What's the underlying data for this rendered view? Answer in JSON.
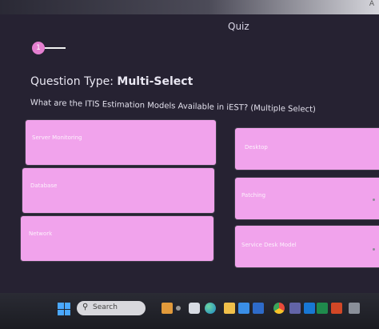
{
  "header": {
    "title": "Quiz",
    "corner_text": "A"
  },
  "progress": {
    "current_step": "1"
  },
  "question": {
    "type_label": "Question Type:",
    "type_value": "Multi-Select",
    "text": "What are the ITIS Estimation Models Available in iEST? (Multiple Select)"
  },
  "options": [
    {
      "label": "Server Monitoring"
    },
    {
      "label": "Desktop"
    },
    {
      "label": "Database"
    },
    {
      "label": "Patching"
    },
    {
      "label": "Network"
    },
    {
      "label": "Service Desk Model"
    }
  ],
  "taskbar": {
    "search_placeholder": "Search",
    "icons": [
      "windows-start-icon",
      "search-icon",
      "briefcase-icon",
      "camera-icon",
      "edge-icon",
      "folder-icon",
      "store-icon",
      "word-icon",
      "chrome-icon",
      "teams-icon",
      "outlook-icon",
      "excel-icon",
      "powerpoint-icon",
      "app-icon"
    ]
  },
  "colors": {
    "option_fill": "#f1a3ec",
    "progress_accent": "#e47fd0",
    "background": "#262232"
  }
}
